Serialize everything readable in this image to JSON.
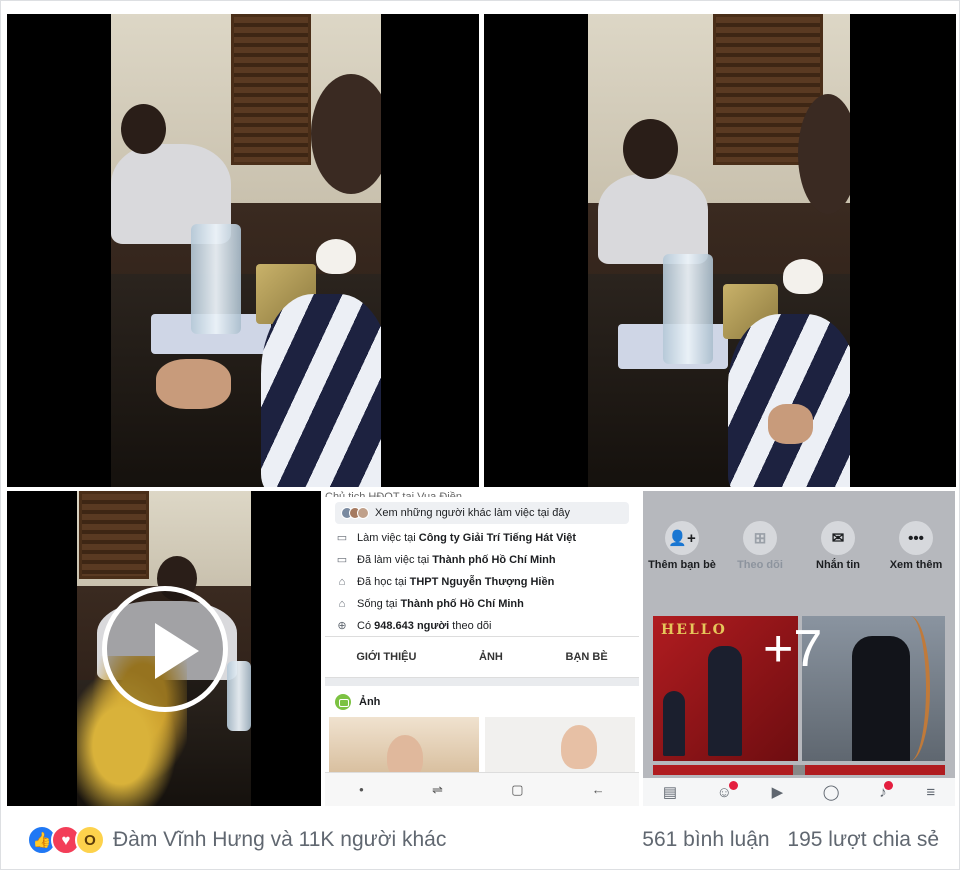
{
  "profile_screen_d": {
    "truncated_top": "Chủ tịch HĐQT tại Vua Điền",
    "see_others": "Xem những người khác làm việc tại đây",
    "info": [
      {
        "prefix": "Làm việc tại",
        "value": "Công ty Giải Trí Tiếng Hát Việt",
        "suffix": ""
      },
      {
        "prefix": "Đã làm việc tại",
        "value": "Thành phố Hồ Chí Minh",
        "suffix": ""
      },
      {
        "prefix": "Đã học tại",
        "value": "THPT Nguyễn Thượng Hiền",
        "suffix": ""
      },
      {
        "prefix": "Sống tại",
        "value": "Thành phố Hồ Chí Minh",
        "suffix": ""
      },
      {
        "prefix": "Có",
        "value": "948.643 người",
        "suffix": "theo dõi"
      }
    ],
    "tabs": [
      "GIỚI THIỆU",
      "ẢNH",
      "BẠN BÈ"
    ],
    "photos_heading": "Ảnh"
  },
  "profile_screen_e": {
    "actions": [
      {
        "label": "Thêm bạn bè",
        "icon": "add-friend-icon",
        "glyph": "👤+"
      },
      {
        "label": "Theo dõi",
        "icon": "follow-icon",
        "glyph": "⊞"
      },
      {
        "label": "Nhắn tin",
        "icon": "messenger-icon",
        "glyph": "✉"
      },
      {
        "label": "Xem thêm",
        "icon": "more-icon",
        "glyph": "•••"
      }
    ],
    "more_photos": "+7",
    "poster_text": "HELLO"
  },
  "footer": {
    "reactions": [
      "like",
      "love",
      "wow"
    ],
    "reaction_names": "Đàm Vĩnh Hưng và 11K người khác",
    "comments": "561 bình luận",
    "shares": "195 lượt chia sẻ"
  },
  "colors": {
    "like": "#2078f4",
    "love": "#f33e58",
    "wow": "#fdd24c",
    "meta_text": "#606770"
  }
}
